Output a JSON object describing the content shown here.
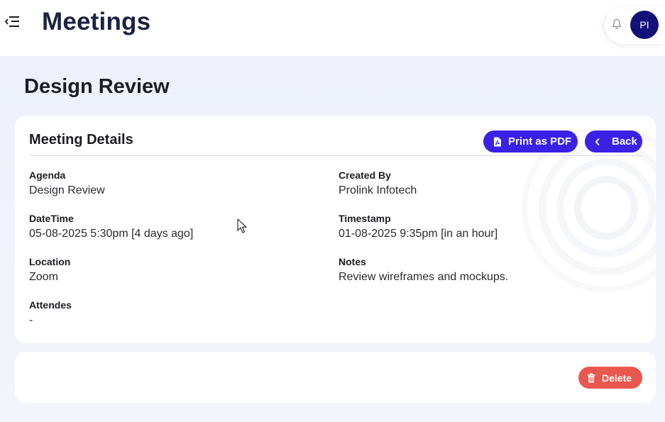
{
  "header": {
    "title": "Meetings",
    "avatar_initials": "PI",
    "menu_icon": "menu-collapse-icon",
    "notification_icon": "bell-icon"
  },
  "page": {
    "title": "Design Review"
  },
  "details_card": {
    "title": "Meeting Details",
    "print_button_label": "Print as PDF",
    "back_button_label": "Back",
    "fields": {
      "agenda": {
        "label": "Agenda",
        "value": "Design Review"
      },
      "created_by": {
        "label": "Created By",
        "value": "Prolink Infotech"
      },
      "datetime": {
        "label": "DateTime",
        "value": "05-08-2025 5:30pm [4 days ago]"
      },
      "timestamp": {
        "label": "Timestamp",
        "value": "01-08-2025 9:35pm [in an hour]"
      },
      "location": {
        "label": "Location",
        "value": "Zoom"
      },
      "notes": {
        "label": "Notes",
        "value": "Review wireframes and mockups."
      },
      "attendees": {
        "label": "Attendes",
        "value": "-"
      }
    }
  },
  "actions_card": {
    "delete_button_label": "Delete"
  },
  "colors": {
    "primary": "#3b20e6",
    "danger": "#e9584e",
    "avatar_bg": "#14107a",
    "heading": "#1c2340"
  }
}
